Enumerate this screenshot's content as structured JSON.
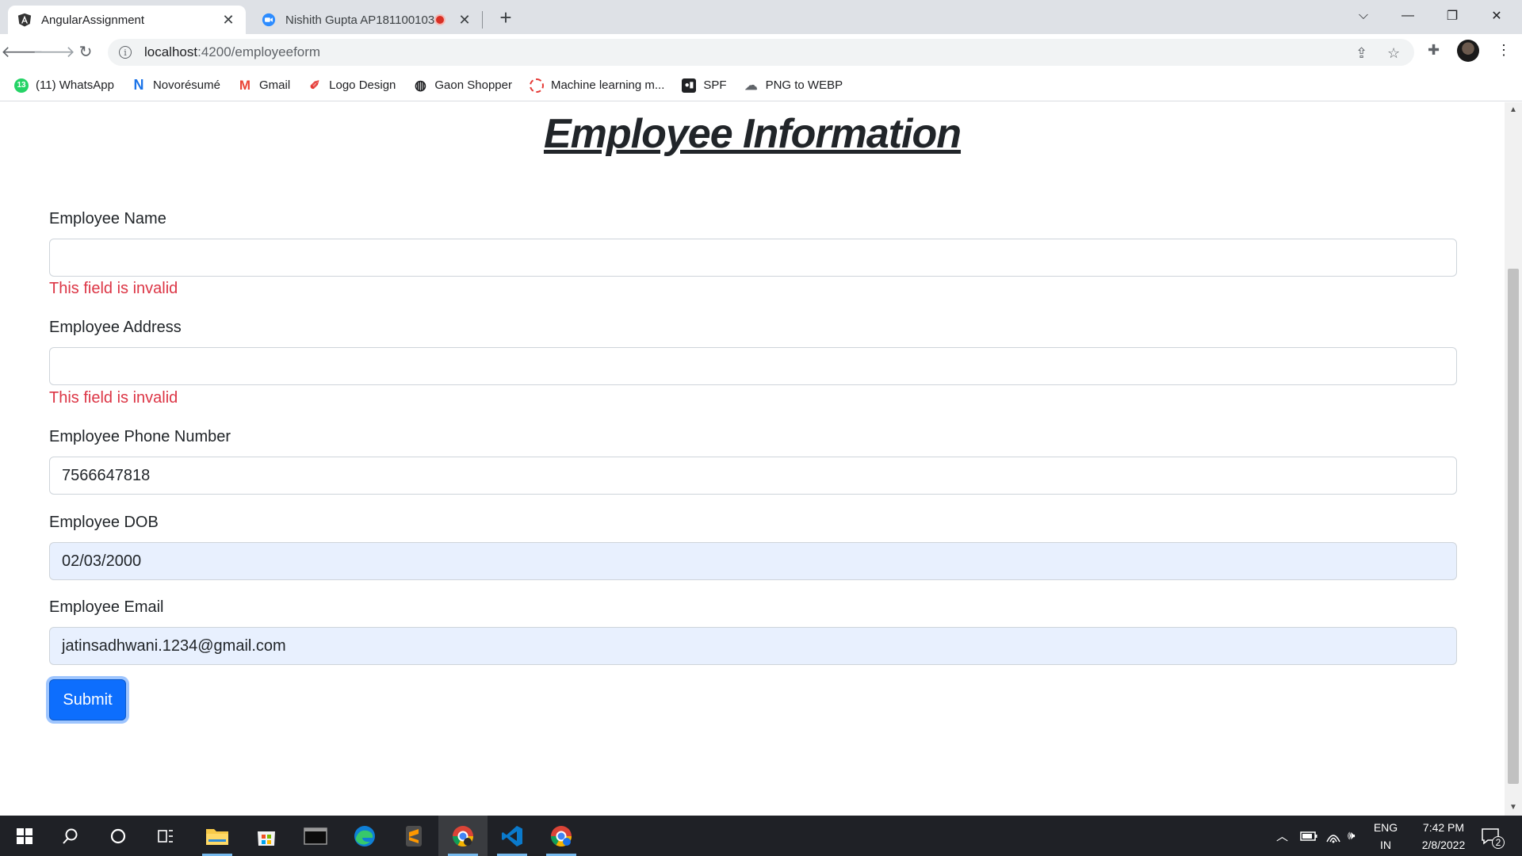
{
  "browser": {
    "tabs": [
      {
        "title": "AngularAssignment",
        "favicon": "angular-icon",
        "active": true
      },
      {
        "title": "Nishith Gupta AP181100103",
        "favicon": "zoom-icon",
        "active": false,
        "recording": true
      }
    ],
    "url_host": "localhost",
    "url_path": ":4200/employeeform",
    "bookmarks": [
      {
        "label": "(11) WhatsApp",
        "icon": "whatsapp-icon",
        "color": "#25d366"
      },
      {
        "label": "Novorésumé",
        "icon": "novoresume-icon",
        "color": "#1a73e8"
      },
      {
        "label": "Gmail",
        "icon": "gmail-icon",
        "color": "#ea4335"
      },
      {
        "label": "Logo Design",
        "icon": "logo-design-icon",
        "color": "#e53935"
      },
      {
        "label": "Gaon Shopper",
        "icon": "globe-icon",
        "color": "#202124"
      },
      {
        "label": "Machine learning m...",
        "icon": "machine-learning-icon",
        "color": "#e53935"
      },
      {
        "label": "SPF",
        "icon": "spf-icon",
        "color": "#202124"
      },
      {
        "label": "PNG to WEBP",
        "icon": "cloud-icon",
        "color": "#5f6368"
      }
    ]
  },
  "form": {
    "heading": "Employee Information",
    "name_label": "Employee Name",
    "name_value": "",
    "name_error": "This field is invalid",
    "address_label": "Employee Address",
    "address_value": "",
    "address_error": "This field is invalid",
    "phone_label": "Employee Phone Number",
    "phone_value": "7566647818",
    "dob_label": "Employee DOB",
    "dob_value": "02/03/2000",
    "email_label": "Employee Email",
    "email_value": "jatinsadhwani.1234@gmail.com",
    "submit_label": "Submit"
  },
  "taskbar": {
    "lang_line1": "ENG",
    "lang_line2": "IN",
    "time": "7:42 PM",
    "date": "2/8/2022",
    "notification_count": "2"
  },
  "colors": {
    "primary": "#0d6efd",
    "error": "#dc3545",
    "autofill": "#e8f0fe"
  }
}
